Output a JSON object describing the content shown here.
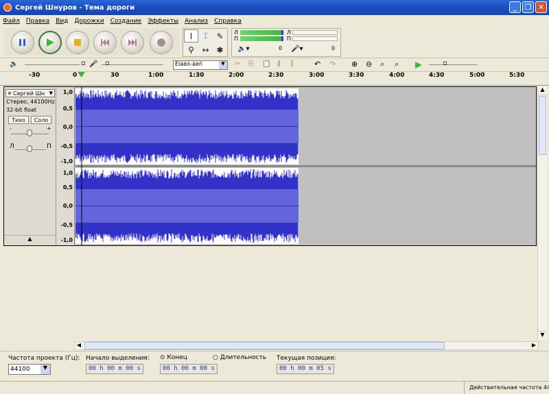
{
  "window": {
    "title": "Сергей Шнуров - Тема дороги"
  },
  "menu": [
    "Файл",
    "Правка",
    "Вид",
    "Дорожки",
    "Создание",
    "Эффекты",
    "Анализ",
    "Справка"
  ],
  "meters": {
    "left_label": "Л",
    "right_label": "П",
    "in_left": "Л",
    "in_right": "П",
    "out_value": "0",
    "in_value": "0"
  },
  "edit": {
    "device": "Ёläëö-äëñ"
  },
  "ruler": {
    "ticks": [
      "-30",
      "0",
      "30",
      "1:00",
      "1:30",
      "2:00",
      "2:30",
      "3:00",
      "3:30",
      "4:00",
      "4:30",
      "5:00",
      "5:30"
    ]
  },
  "track": {
    "name": "Сергей Шн",
    "info1": "Стерео, 44100Hz",
    "info2": "32-bit float",
    "mute": "Тихо",
    "solo": "Соло",
    "gain_minus": "-",
    "gain_plus": "+",
    "pan_left": "Л",
    "pan_right": "П",
    "scale_top": [
      "1,0",
      "0,5",
      "0,0",
      "-0,5",
      "-1,0"
    ],
    "scale_bottom": [
      "1,0",
      "0,5",
      "0,0",
      "-0,5",
      "-1,0"
    ],
    "waveform_end_fraction": 0.485,
    "wave_color": "#3232c8",
    "wave_rms_color": "#6464dc"
  },
  "bottom": {
    "rate_label": "Частота проекта (Гц):",
    "rate_value": "44100",
    "sel_start_label": "Начало выделения:",
    "end_label": "Конец",
    "length_label": "Длительность",
    "pos_label": "Текущая позиция:",
    "sel_start_value": "00 h 00 m 00 s",
    "end_value": "00 h 00 m 00 s",
    "pos_value": "00 h 00 m 05 s"
  },
  "status": {
    "text": "Действительная частота 44"
  }
}
